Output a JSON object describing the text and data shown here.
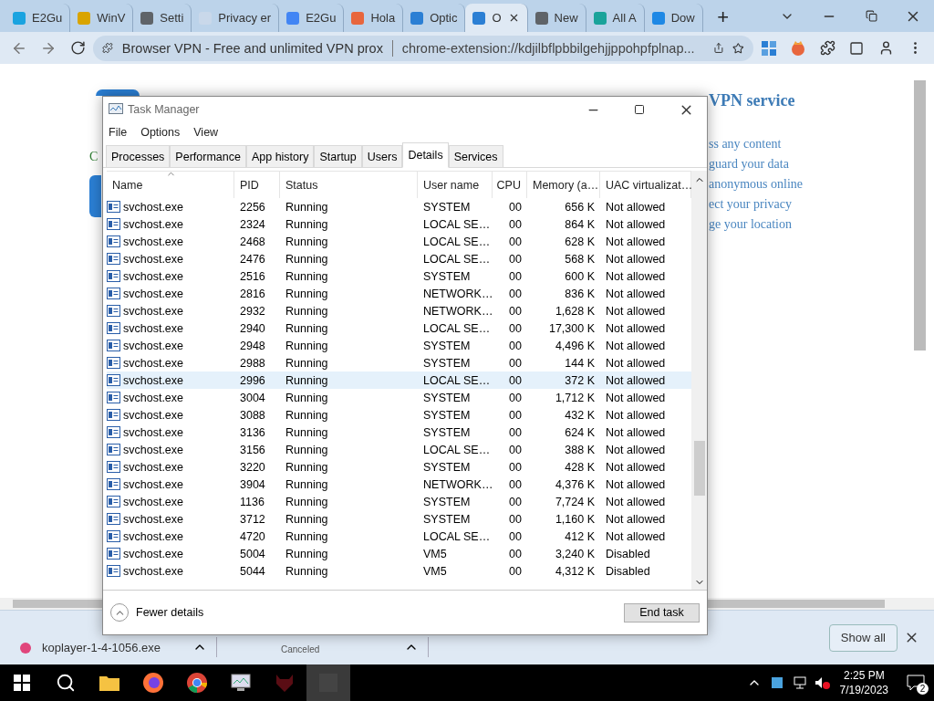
{
  "browser": {
    "tabs": [
      {
        "title": "E2Gu",
        "color": "#1aa3e0",
        "selected": false
      },
      {
        "title": "WinV",
        "color": "#d9a400",
        "selected": false
      },
      {
        "title": "Setti",
        "color": "#5f6368",
        "selected": false
      },
      {
        "title": "Privacy er",
        "color": "#c9d8ea",
        "selected": false
      },
      {
        "title": "E2Gu",
        "color": "#4285f4",
        "selected": false
      },
      {
        "title": "Hola",
        "color": "#e8663d",
        "selected": false
      },
      {
        "title": "Optic",
        "color": "#2b7fd4",
        "selected": false
      },
      {
        "title": "O",
        "color": "#2b7fd4",
        "selected": true
      },
      {
        "title": "New",
        "color": "#5f6368",
        "selected": false
      },
      {
        "title": "All A",
        "color": "#1aa39a",
        "selected": false
      },
      {
        "title": "Dow",
        "color": "#1e88e5",
        "selected": false
      }
    ],
    "new_tab": "+",
    "address": {
      "site_title": "Browser VPN - Free and unlimited VPN prox",
      "url": "chrome-extension://kdjilbflpbbilgehjjppohpfplnap..."
    }
  },
  "page": {
    "left_fragment": "C",
    "heading": "VPN service",
    "features": [
      "ss any content",
      "guard your data",
      "anonymous online",
      "ect your privacy",
      "ge your location"
    ]
  },
  "task_manager": {
    "title": "Task Manager",
    "menu": [
      "File",
      "Options",
      "View"
    ],
    "tabs": [
      {
        "label": "Processes",
        "selected": false
      },
      {
        "label": "Performance",
        "selected": false
      },
      {
        "label": "App history",
        "selected": false
      },
      {
        "label": "Startup",
        "selected": false
      },
      {
        "label": "Users",
        "selected": false
      },
      {
        "label": "Details",
        "selected": true
      },
      {
        "label": "Services",
        "selected": false
      }
    ],
    "columns": [
      "Name",
      "PID",
      "Status",
      "User name",
      "CPU",
      "Memory (a…",
      "UAC virtualizat…"
    ],
    "rows": [
      {
        "name": "svchost.exe",
        "pid": "2256",
        "status": "Running",
        "user": "SYSTEM",
        "cpu": "00",
        "memory": "656 K",
        "uac": "Not allowed",
        "selected": false
      },
      {
        "name": "svchost.exe",
        "pid": "2324",
        "status": "Running",
        "user": "LOCAL SE…",
        "cpu": "00",
        "memory": "864 K",
        "uac": "Not allowed",
        "selected": false
      },
      {
        "name": "svchost.exe",
        "pid": "2468",
        "status": "Running",
        "user": "LOCAL SE…",
        "cpu": "00",
        "memory": "628 K",
        "uac": "Not allowed",
        "selected": false
      },
      {
        "name": "svchost.exe",
        "pid": "2476",
        "status": "Running",
        "user": "LOCAL SE…",
        "cpu": "00",
        "memory": "568 K",
        "uac": "Not allowed",
        "selected": false
      },
      {
        "name": "svchost.exe",
        "pid": "2516",
        "status": "Running",
        "user": "SYSTEM",
        "cpu": "00",
        "memory": "600 K",
        "uac": "Not allowed",
        "selected": false
      },
      {
        "name": "svchost.exe",
        "pid": "2816",
        "status": "Running",
        "user": "NETWORK…",
        "cpu": "00",
        "memory": "836 K",
        "uac": "Not allowed",
        "selected": false
      },
      {
        "name": "svchost.exe",
        "pid": "2932",
        "status": "Running",
        "user": "NETWORK…",
        "cpu": "00",
        "memory": "1,628 K",
        "uac": "Not allowed",
        "selected": false
      },
      {
        "name": "svchost.exe",
        "pid": "2940",
        "status": "Running",
        "user": "LOCAL SE…",
        "cpu": "00",
        "memory": "17,300 K",
        "uac": "Not allowed",
        "selected": false
      },
      {
        "name": "svchost.exe",
        "pid": "2948",
        "status": "Running",
        "user": "SYSTEM",
        "cpu": "00",
        "memory": "4,496 K",
        "uac": "Not allowed",
        "selected": false
      },
      {
        "name": "svchost.exe",
        "pid": "2988",
        "status": "Running",
        "user": "SYSTEM",
        "cpu": "00",
        "memory": "144 K",
        "uac": "Not allowed",
        "selected": false
      },
      {
        "name": "svchost.exe",
        "pid": "2996",
        "status": "Running",
        "user": "LOCAL SE…",
        "cpu": "00",
        "memory": "372 K",
        "uac": "Not allowed",
        "selected": true
      },
      {
        "name": "svchost.exe",
        "pid": "3004",
        "status": "Running",
        "user": "SYSTEM",
        "cpu": "00",
        "memory": "1,712 K",
        "uac": "Not allowed",
        "selected": false
      },
      {
        "name": "svchost.exe",
        "pid": "3088",
        "status": "Running",
        "user": "SYSTEM",
        "cpu": "00",
        "memory": "432 K",
        "uac": "Not allowed",
        "selected": false
      },
      {
        "name": "svchost.exe",
        "pid": "3136",
        "status": "Running",
        "user": "SYSTEM",
        "cpu": "00",
        "memory": "624 K",
        "uac": "Not allowed",
        "selected": false
      },
      {
        "name": "svchost.exe",
        "pid": "3156",
        "status": "Running",
        "user": "LOCAL SE…",
        "cpu": "00",
        "memory": "388 K",
        "uac": "Not allowed",
        "selected": false
      },
      {
        "name": "svchost.exe",
        "pid": "3220",
        "status": "Running",
        "user": "SYSTEM",
        "cpu": "00",
        "memory": "428 K",
        "uac": "Not allowed",
        "selected": false
      },
      {
        "name": "svchost.exe",
        "pid": "3904",
        "status": "Running",
        "user": "NETWORK…",
        "cpu": "00",
        "memory": "4,376 K",
        "uac": "Not allowed",
        "selected": false
      },
      {
        "name": "svchost.exe",
        "pid": "1136",
        "status": "Running",
        "user": "SYSTEM",
        "cpu": "00",
        "memory": "7,724 K",
        "uac": "Not allowed",
        "selected": false
      },
      {
        "name": "svchost.exe",
        "pid": "3712",
        "status": "Running",
        "user": "SYSTEM",
        "cpu": "00",
        "memory": "1,160 K",
        "uac": "Not allowed",
        "selected": false
      },
      {
        "name": "svchost.exe",
        "pid": "4720",
        "status": "Running",
        "user": "LOCAL SE…",
        "cpu": "00",
        "memory": "412 K",
        "uac": "Not allowed",
        "selected": false
      },
      {
        "name": "svchost.exe",
        "pid": "5004",
        "status": "Running",
        "user": "VM5",
        "cpu": "00",
        "memory": "3,240 K",
        "uac": "Disabled",
        "selected": false
      },
      {
        "name": "svchost.exe",
        "pid": "5044",
        "status": "Running",
        "user": "VM5",
        "cpu": "00",
        "memory": "4,312 K",
        "uac": "Disabled",
        "selected": false
      }
    ],
    "fewer_details": "Fewer details",
    "end_task": "End task"
  },
  "downloads": {
    "items": [
      {
        "name": "koplayer-1-4-1056.exe"
      },
      {
        "status": "Canceled"
      }
    ],
    "show_all": "Show all"
  },
  "taskbar": {
    "apps": [
      {
        "kind": "folder",
        "selected": false
      },
      {
        "kind": "firefox",
        "selected": false
      },
      {
        "kind": "chrome",
        "selected": false
      },
      {
        "kind": "monitor",
        "selected": false
      },
      {
        "kind": "mask",
        "selected": false
      },
      {
        "kind": "blank",
        "selected": true
      }
    ],
    "time": "2:25 PM",
    "date": "7/19/2023",
    "notifications": "2"
  }
}
